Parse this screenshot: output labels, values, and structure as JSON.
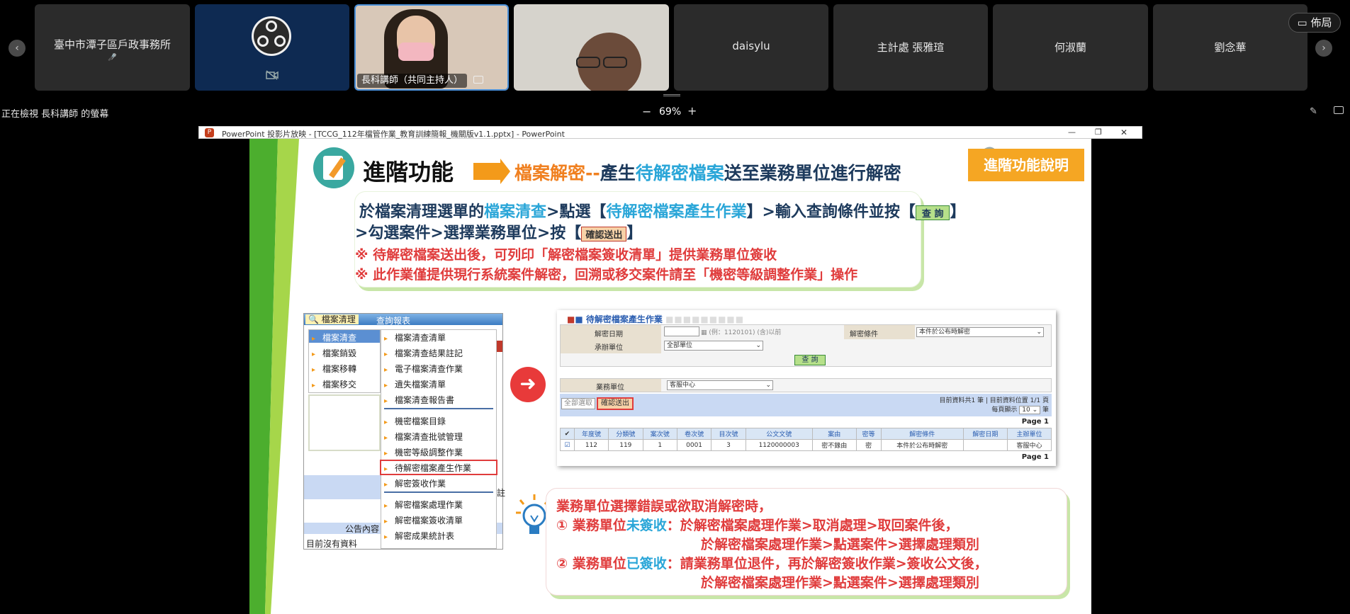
{
  "participants": [
    {
      "name": "臺中市潭子區戶政事務所",
      "sub": "🎤"
    },
    {
      "name": ""
    },
    {
      "name": "長科講師（共同主持人）"
    },
    {
      "name": ""
    },
    {
      "name": "daisylu"
    },
    {
      "name": "主計處 張雅瑄"
    },
    {
      "name": "何淑蘭"
    },
    {
      "name": "劉念華"
    }
  ],
  "layout_button": "佈局",
  "viewing_label": "正在檢視 長科講師 的螢幕",
  "zoom": {
    "minus": "−",
    "value": "69%",
    "plus": "+"
  },
  "ppt_window": {
    "title": "PowerPoint 投影片放映 - [TCCG_112年檔管作業_教育訓練簡報_機關版v1.1.pptx] - PowerPoint",
    "min": "—",
    "max": "❐",
    "close": "✕"
  },
  "slide": {
    "heading": "進階功能",
    "sub_a": "檔案解密--",
    "sub_b": "產生",
    "sub_c": "待解密檔案",
    "sub_d": "送至業務單位進行解密",
    "badge": "進階功能說明",
    "inst": {
      "l1a": "於檔案清理選單的",
      "l1b": "檔案清查",
      "l1c": ">點選【",
      "l1d": "待解密檔案產生作業",
      "l1e": "】>輸入查詢條件並按【",
      "l1btn": "查 詢",
      "l1f": "】",
      "l2a": ">勾選案件>選擇業務單位>按【",
      "l2btn": "確認送出",
      "l2b": "】",
      "n1": "※ 待解密檔案送出後，可列印「解密檔案簽收清單」提供業務單位簽收",
      "n2": "※ 此作業僅提供現行系統案件解密，回溯或移交案件請至「機密等級調整作業」操作"
    },
    "menu": {
      "tab1": "檔案清理",
      "tab2": "查詢報表",
      "left": [
        "檔案清查",
        "檔案銷毀",
        "檔案移轉",
        "檔案移交"
      ],
      "right": [
        "檔案清查清單",
        "檔案清查結果註記",
        "電子檔案清查作業",
        "遺失檔案清單",
        "檔案清查報告書",
        "機密檔案目錄",
        "檔案清查批號管理",
        "機密等級調整作業",
        "待解密檔案產生作業",
        "解密簽收作業",
        "解密檔案處理作業",
        "解密檔案簽收清單",
        "解密成果統計表"
      ],
      "notice": "公告內容",
      "nodata": "目前沒有資料",
      "side": "註"
    },
    "form": {
      "title": "待解密檔案產生作業",
      "date_label": "解密日期",
      "date_hint": "(例：1120101) (含)以前",
      "cond_label": "解密條件",
      "cond_value": "本件於公布時解密",
      "unit_label": "承辦單位",
      "unit_value": "全部單位",
      "query": "查 詢",
      "biz_label": "業務單位",
      "biz_value": "客服中心",
      "select_all": "全部選取",
      "confirm": "確認送出",
      "info": "目前資料共1 筆 | 目前資料位置 1/1 頁",
      "perpage_label": "每頁顯示",
      "perpage_value": "10",
      "perpage_unit": "筆",
      "page": "Page 1",
      "headers": [
        "✔",
        "年度號",
        "分類號",
        "案次號",
        "卷次號",
        "目次號",
        "公文文號",
        "案由",
        "密等",
        "解密條件",
        "解密日期",
        "主辦單位"
      ],
      "row": [
        "☑",
        "112",
        "119",
        "1",
        "0001",
        "3",
        "1120000003",
        "密不錄由",
        "密",
        "本件於公布時解密",
        "",
        "客服中心"
      ]
    },
    "tip": {
      "t1": "業務單位選擇錯誤或欲取消解密時，",
      "a_num": "① 業務單位",
      "a_key": "未簽收",
      "a_rest": "：於解密檔案處理作業>取消處理>取回案件後，",
      "a_cont": "於解密檔案處理作業>點選案件>選擇處理類別",
      "b_num": "② 業務單位",
      "b_key": "已簽收",
      "b_rest": "：請業務單位退件，再於解密簽收作業>簽收公文後，",
      "b_cont": "於解密檔案處理作業>點選案件>選擇處理類別"
    }
  }
}
